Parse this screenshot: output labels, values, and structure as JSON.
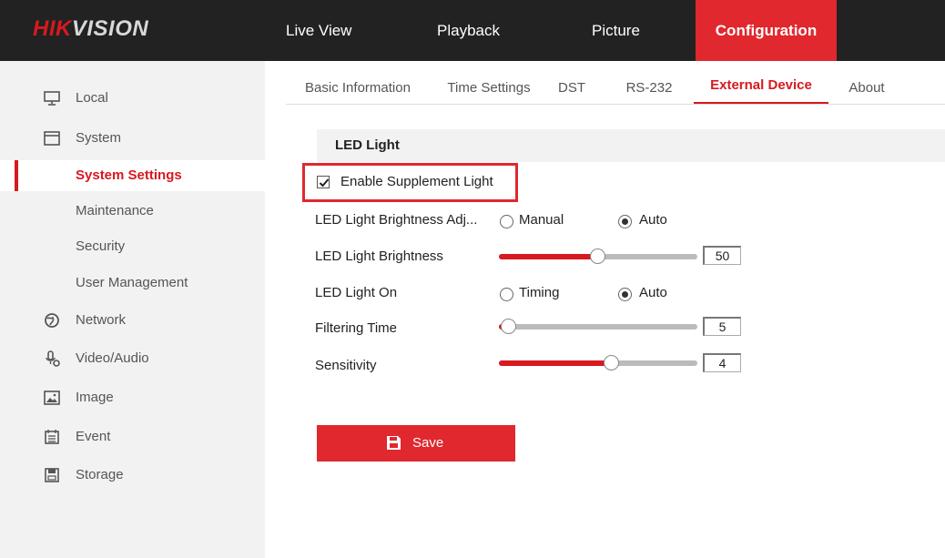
{
  "brand": {
    "part1": "HIK",
    "part2": "VISION"
  },
  "topnav": [
    {
      "label": "Live View"
    },
    {
      "label": "Playback"
    },
    {
      "label": "Picture"
    },
    {
      "label": "Configuration",
      "active": true
    }
  ],
  "sidebar": {
    "items": [
      {
        "label": "Local",
        "icon": "monitor-icon"
      },
      {
        "label": "System",
        "icon": "window-icon"
      },
      {
        "label": "System Settings",
        "active": true
      },
      {
        "label": "Maintenance"
      },
      {
        "label": "Security"
      },
      {
        "label": "User Management"
      },
      {
        "label": "Network",
        "icon": "globe-icon"
      },
      {
        "label": "Video/Audio",
        "icon": "microphone-icon"
      },
      {
        "label": "Image",
        "icon": "image-icon"
      },
      {
        "label": "Event",
        "icon": "calendar-icon"
      },
      {
        "label": "Storage",
        "icon": "storage-icon"
      }
    ]
  },
  "tabs": [
    {
      "label": "Basic Information"
    },
    {
      "label": "Time Settings"
    },
    {
      "label": "DST"
    },
    {
      "label": "RS-232"
    },
    {
      "label": "External Device",
      "active": true
    },
    {
      "label": "About"
    }
  ],
  "section": {
    "title": "LED Light"
  },
  "supplement": {
    "label": "Enable Supplement Light",
    "checked": true
  },
  "brightness_adj": {
    "label": "LED Light Brightness Adj...",
    "options": [
      {
        "label": "Manual",
        "checked": false
      },
      {
        "label": "Auto",
        "checked": true
      }
    ]
  },
  "brightness": {
    "label": "LED Light Brightness",
    "value": "50",
    "fraction": 0.5
  },
  "led_on": {
    "label": "LED Light On",
    "options": [
      {
        "label": "Timing",
        "checked": false
      },
      {
        "label": "Auto",
        "checked": true
      }
    ]
  },
  "filtering": {
    "label": "Filtering Time",
    "value": "5",
    "fraction": 0.05
  },
  "sensitivity": {
    "label": "Sensitivity",
    "value": "4",
    "fraction": 0.57
  },
  "save": {
    "label": "Save"
  },
  "colors": {
    "accent": "#e0282e",
    "topbar": "#222222",
    "sidebar": "#f2f2f2"
  }
}
